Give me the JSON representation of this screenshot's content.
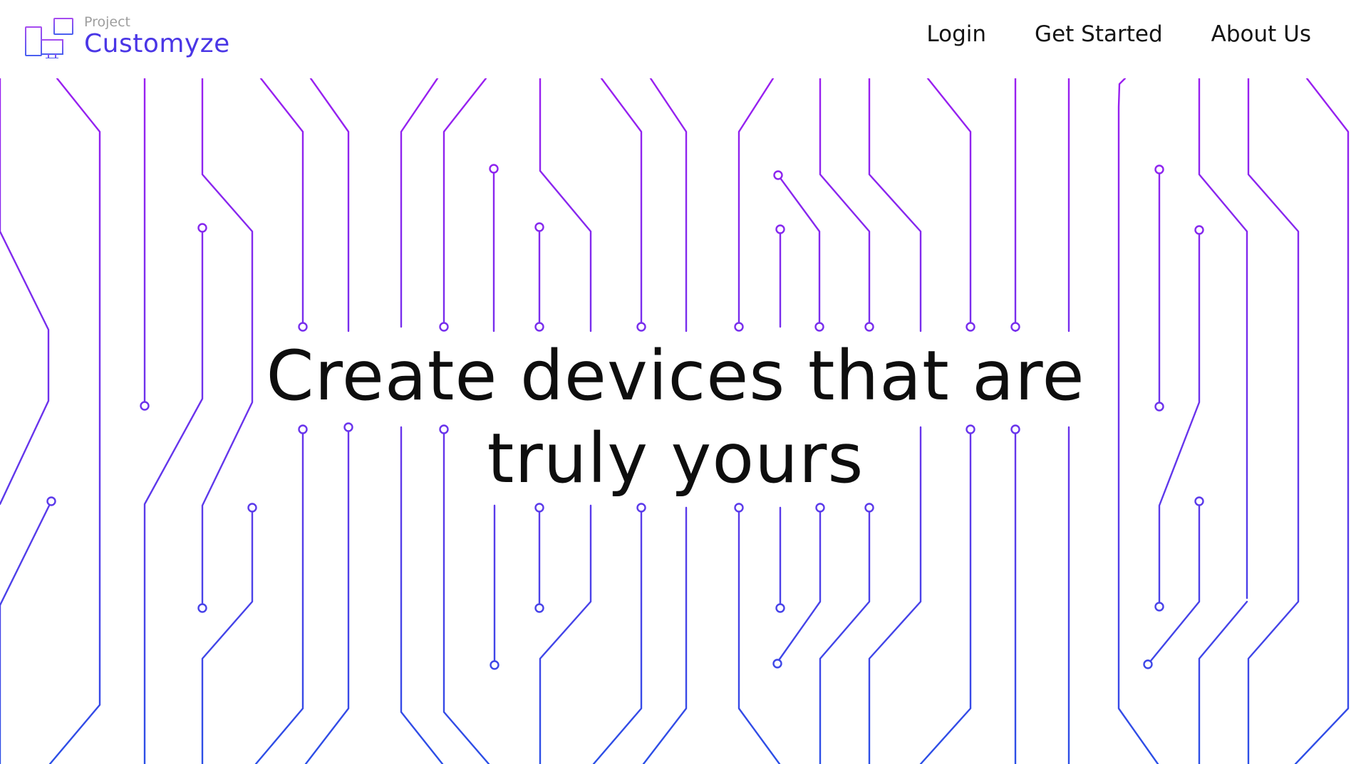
{
  "brand": {
    "subtitle": "Project",
    "name": "Customyze",
    "logo_icon": "devices-icon",
    "color": "#4a36e6"
  },
  "nav": {
    "items": [
      {
        "label": "Login"
      },
      {
        "label": "Get Started"
      },
      {
        "label": "About Us"
      }
    ]
  },
  "hero": {
    "line1": "Create devices that are",
    "line2": "truly yours"
  },
  "background": {
    "pattern": "circuit-traces",
    "gradient_top": "#9a1ff0",
    "gradient_bottom": "#2b4fe6"
  }
}
